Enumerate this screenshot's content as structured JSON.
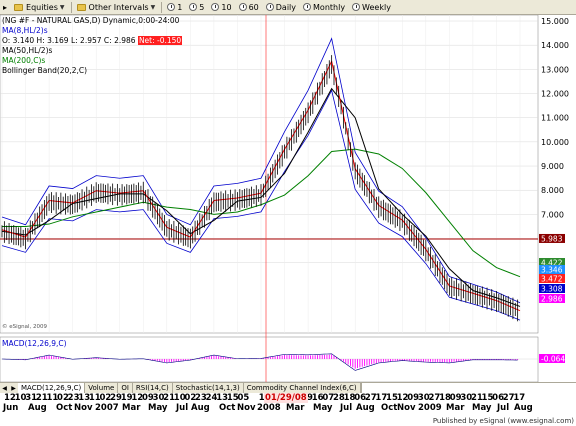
{
  "toolbar": {
    "symbol_menu": "▸",
    "equities": "Equities",
    "other_intervals": "Other Intervals",
    "intervals": [
      "1",
      "5",
      "10",
      "60",
      "Daily",
      "Monthly",
      "Weekly"
    ]
  },
  "legend": {
    "title": "(NG #F - NATURAL GAS,D) Dynamic,0:00-24:00",
    "ma8": "MA(8,HL/2)s",
    "ohlc": {
      "o": "O: 3.140",
      "h": "H: 3.169",
      "l": "L: 2.957",
      "c": "C: 2.986",
      "net": "Net: -0.150"
    },
    "ma50": "MA(50,HL/2)s",
    "ma200": "MA(200,C)s",
    "bollinger": "Bollinger Band(20,2,C)",
    "watermark": "© eSignal, 2009"
  },
  "price_axis": {
    "labels": [
      "15.000",
      "14.000",
      "13.000",
      "12.000",
      "11.000",
      "10.000",
      "9.000",
      "8.000",
      "7.000",
      "6.000",
      "5.000"
    ],
    "badges": [
      {
        "text": "5.983",
        "color": "#8b0000"
      },
      {
        "text": "4.422",
        "color": "#2e8b2e"
      },
      {
        "text": "3.346",
        "color": "#1e90ff"
      },
      {
        "text": "3.472",
        "color": "#ff2020"
      },
      {
        "text": "3.308",
        "color": "#0000cc"
      },
      {
        "text": "2.986",
        "color": "#ff00ff"
      }
    ]
  },
  "macd": {
    "label": "MACD(12,26,9,C)",
    "badge": "-0.064",
    "badge_color": "#ff00ff"
  },
  "indicator_tabs": [
    "MACD(12,26,9,C)",
    "Volume",
    "OI",
    "RSI(14,C)",
    "Stochastic(14,1,3)",
    "Commodity Channel Index(6,C)"
  ],
  "cursor_date": "01/29/08",
  "x_axis": {
    "days": [
      "12",
      "10",
      "31",
      "21",
      "11",
      "02",
      "23",
      "13",
      "11",
      "02",
      "29",
      "19",
      "12",
      "09",
      "30",
      "21",
      "10",
      "02",
      "23",
      "24",
      "13",
      "15",
      "05",
      "",
      "19",
      "10",
      "02",
      "29",
      "19",
      "16",
      "07",
      "28",
      "18",
      "06",
      "27",
      "17",
      "15",
      "12",
      "09",
      "30",
      "27",
      "18",
      "09",
      "30",
      "21",
      "15",
      "06",
      "27",
      "17"
    ],
    "months": [
      {
        "text": "Jun",
        "x": 3
      },
      {
        "text": "Aug",
        "x": 28
      },
      {
        "text": "Oct",
        "x": 56
      },
      {
        "text": "Nov",
        "x": 74
      },
      {
        "text": "2007",
        "x": 95
      },
      {
        "text": "Mar",
        "x": 122
      },
      {
        "text": "May",
        "x": 148
      },
      {
        "text": "Jul",
        "x": 176
      },
      {
        "text": "Aug",
        "x": 191
      },
      {
        "text": "Oct",
        "x": 219
      },
      {
        "text": "Nov",
        "x": 237
      },
      {
        "text": "2008",
        "x": 257
      },
      {
        "text": "Mar",
        "x": 286
      },
      {
        "text": "May",
        "x": 313
      },
      {
        "text": "Jul",
        "x": 340
      },
      {
        "text": "Aug",
        "x": 356
      },
      {
        "text": "Oct",
        "x": 381
      },
      {
        "text": "Nov",
        "x": 397
      },
      {
        "text": "2009",
        "x": 418
      },
      {
        "text": "Mar",
        "x": 446
      },
      {
        "text": "May",
        "x": 472
      },
      {
        "text": "Jul",
        "x": 497
      },
      {
        "text": "Aug",
        "x": 514
      }
    ]
  },
  "footer": "Published by eSignal (www.esignal.com)",
  "colors": {
    "price": "#000000",
    "ma8": "#ff0000",
    "ma50": "#000000",
    "ma200": "#008000",
    "bollinger": "#0000cc",
    "macd": "#ff00ff",
    "support_line": "#aa0000",
    "cursor_line": "#ff4040"
  },
  "chart_data": {
    "type": "line",
    "title": "(NG #F - NATURAL GAS,D) Dynamic,0:00-24:00",
    "xlabel": "",
    "ylabel": "",
    "ylim": [
      2.3,
      15.0
    ],
    "x": [
      "2006-06",
      "2006-08",
      "2006-10",
      "2006-11",
      "2007-01",
      "2007-03",
      "2007-05",
      "2007-07",
      "2007-08",
      "2007-10",
      "2007-11",
      "2008-01",
      "2008-03",
      "2008-05",
      "2008-07",
      "2008-08",
      "2008-10",
      "2008-11",
      "2009-01",
      "2009-03",
      "2009-05",
      "2009-07",
      "2009-08"
    ],
    "series": [
      {
        "name": "NG #F",
        "values": [
          6.3,
          6.0,
          7.5,
          7.4,
          7.9,
          7.8,
          7.9,
          6.4,
          6.0,
          7.5,
          7.6,
          7.8,
          9.6,
          11.2,
          13.2,
          8.8,
          7.3,
          6.7,
          5.5,
          4.0,
          3.7,
          3.4,
          2.986
        ]
      },
      {
        "name": "MA(200,C)s",
        "values": [
          6.5,
          6.5,
          6.6,
          6.9,
          7.1,
          7.3,
          7.5,
          7.3,
          7.2,
          7.0,
          7.1,
          7.4,
          7.8,
          8.6,
          9.6,
          9.7,
          9.5,
          8.9,
          7.9,
          6.7,
          5.5,
          4.8,
          4.422
        ]
      }
    ],
    "support_level": 5.983,
    "macd": {
      "name": "MACD(12,26,9,C)",
      "last": -0.064
    }
  }
}
